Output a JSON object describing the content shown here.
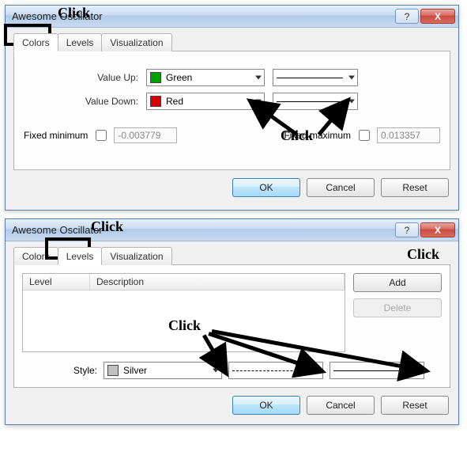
{
  "dialog1": {
    "title": "Awesome Oscillator",
    "tabs": {
      "colors": "Colors",
      "levels": "Levels",
      "visualization": "Visualization"
    },
    "fields": {
      "value_up_label": "Value Up:",
      "value_up_color": "Green",
      "value_down_label": "Value Down:",
      "value_down_color": "Red",
      "fixed_min_label": "Fixed minimum",
      "fixed_min_value": "-0.003779",
      "fixed_max_label": "Fixed maximum",
      "fixed_max_value": "0.013357"
    },
    "buttons": {
      "ok": "OK",
      "cancel": "Cancel",
      "reset": "Reset"
    },
    "annots": {
      "click_tab": "Click",
      "click_combo": "Click"
    }
  },
  "dialog2": {
    "title": "Awesome Oscillator",
    "tabs": {
      "colors": "Colors",
      "levels": "Levels",
      "visualization": "Visualization"
    },
    "table": {
      "hdr_level": "Level",
      "hdr_desc": "Description"
    },
    "side": {
      "add": "Add",
      "delete": "Delete"
    },
    "style": {
      "label": "Style:",
      "color": "Silver"
    },
    "buttons": {
      "ok": "OK",
      "cancel": "Cancel",
      "reset": "Reset"
    },
    "annots": {
      "click_tab": "Click",
      "click_add": "Click",
      "click_style": "Click"
    }
  },
  "titlebar": {
    "help": "?",
    "close": "X"
  }
}
